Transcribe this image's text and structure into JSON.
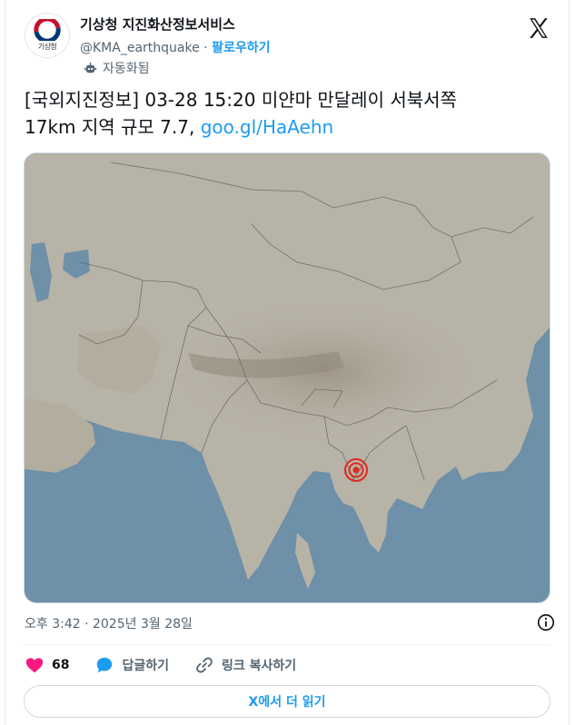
{
  "account": {
    "name": "기상청 지진화산정보서비스",
    "handle": "@KMA_earthquake",
    "separator": "·",
    "follow_label": "팔로우하기",
    "automated_label": "자동화됨",
    "logo_text": "기상청"
  },
  "tweet": {
    "text_line1": "[국외지진정보] 03-28 15:20 미얀마 만달레이 서북서쪽",
    "text_line2": "17km 지역 규모 7.7, ",
    "link": "goo.gl/HaAehn",
    "timestamp": "오후 3:42 · 2025년 3월 28일"
  },
  "actions": {
    "like_count": "68",
    "reply_label": "답글하기",
    "copy_link_label": "링크 복사하기"
  },
  "read_more_label": "X에서 더 읽기",
  "colors": {
    "accent": "#1d9bf0",
    "like": "#f91880",
    "epicenter": "#e0281e"
  },
  "icons": {
    "platform": "x-logo-icon",
    "automated": "robot-icon",
    "info": "info-icon",
    "like": "heart-icon",
    "reply": "speech-bubble-icon",
    "copy": "link-icon"
  }
}
